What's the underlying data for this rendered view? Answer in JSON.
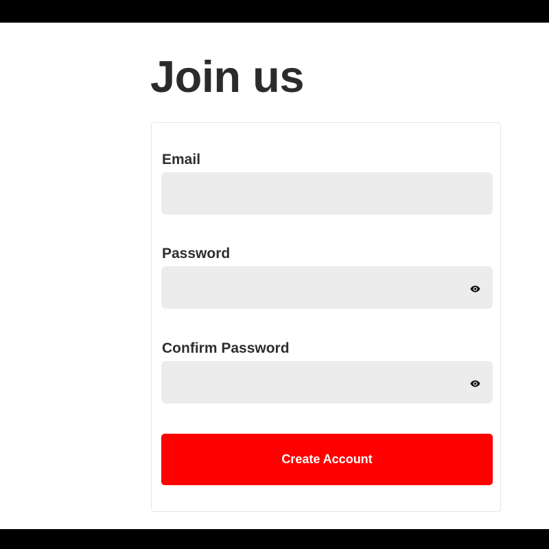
{
  "page": {
    "title": "Join us"
  },
  "form": {
    "fields": [
      {
        "label": "Email",
        "type": "email",
        "value": "",
        "placeholder": ""
      },
      {
        "label": "Password",
        "type": "password",
        "value": "",
        "placeholder": "",
        "icon": "eye-icon"
      },
      {
        "label": "Confirm Password",
        "type": "password",
        "value": "",
        "placeholder": "",
        "icon": "eye-icon"
      }
    ],
    "submit_label": "Create Account"
  },
  "colors": {
    "accent": "#ff0000",
    "input_background": "#ececec",
    "text": "#2b2b2b",
    "frame_bars": "#000000"
  }
}
